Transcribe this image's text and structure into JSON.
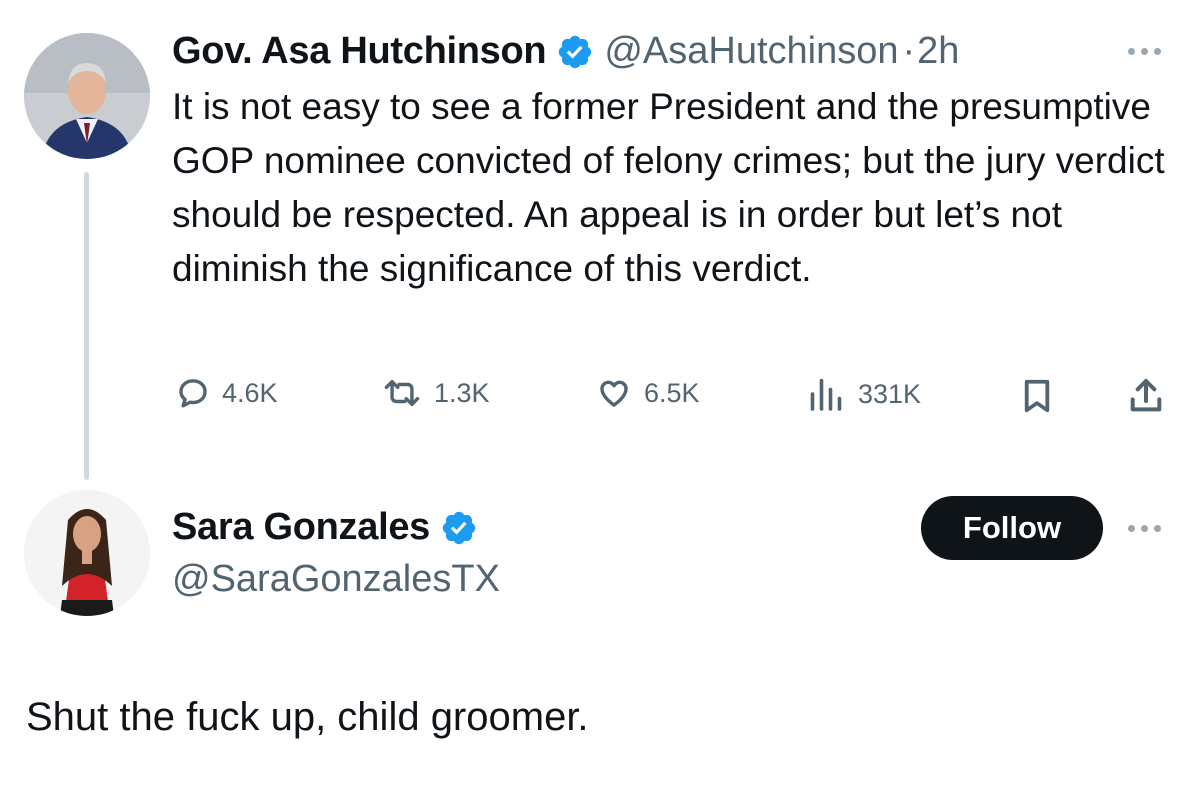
{
  "tweet": {
    "author_name": "Gov. Asa Hutchinson",
    "author_handle": "@AsaHutchinson",
    "separator": "·",
    "time": "2h",
    "text": "It is not easy to see a former President and the presumptive GOP nominee convicted of felony crimes; but the jury verdict should be respected.  An appeal is in order but let’s not diminish the significance of this verdict.",
    "stats": {
      "replies": "4.6K",
      "reposts": "1.3K",
      "likes": "6.5K",
      "views": "331K"
    },
    "icons": [
      "reply-icon",
      "repost-icon",
      "like-icon",
      "views-icon",
      "bookmark-icon",
      "share-icon",
      "more-icon",
      "verified-icon"
    ]
  },
  "reply": {
    "author_name": "Sara Gonzales",
    "author_handle": "@SaraGonzalesTX",
    "follow_label": "Follow",
    "text": "Shut the fuck up, child groomer."
  },
  "colors": {
    "verified": "#1d9bf0",
    "text": "#0f1419",
    "secondary": "#536471",
    "thread_line": "#cfd9de"
  }
}
